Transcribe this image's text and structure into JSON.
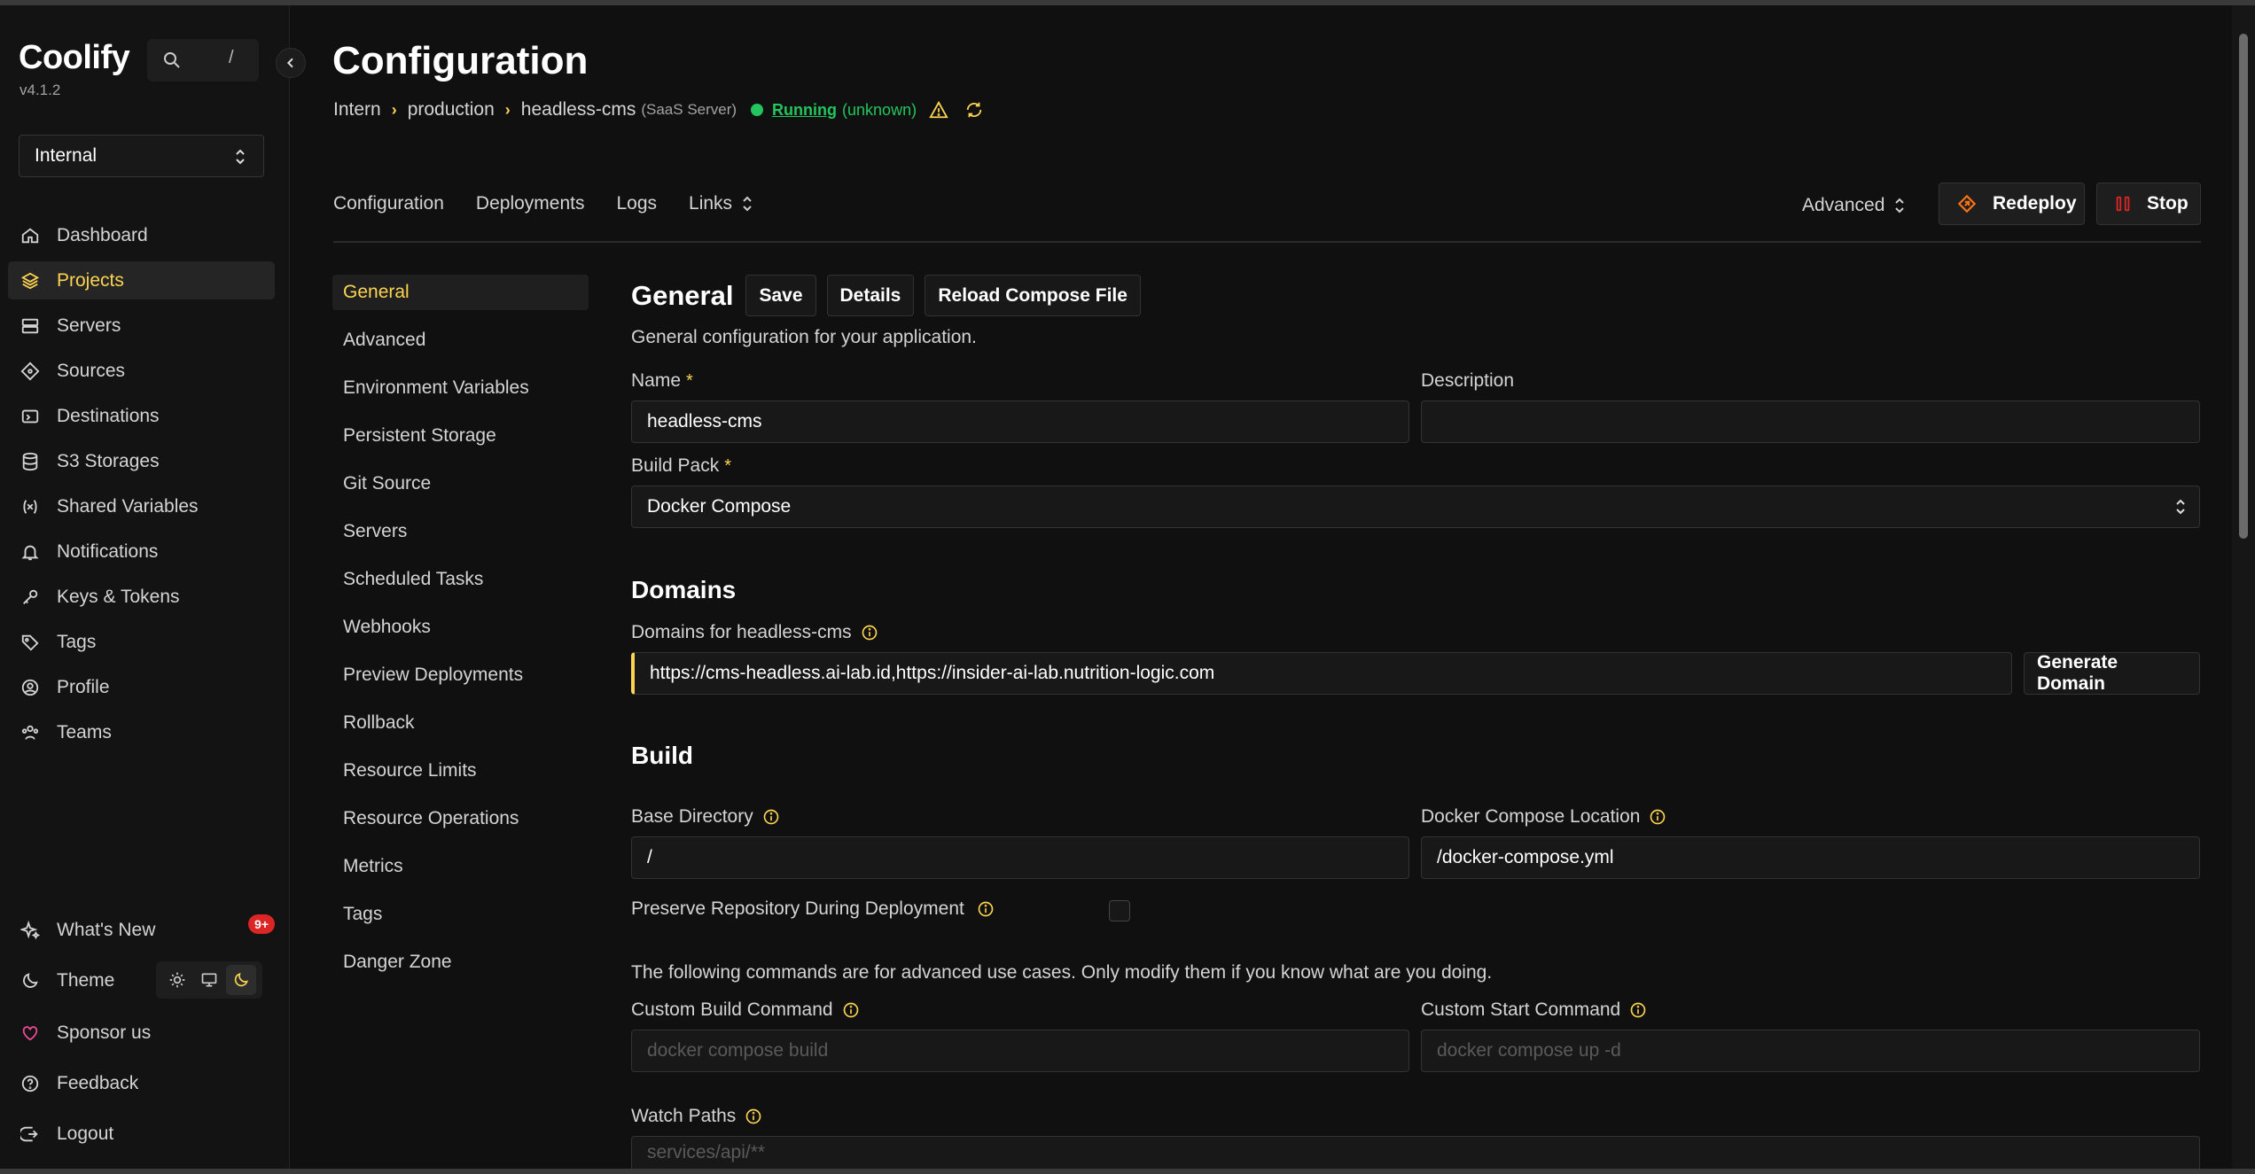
{
  "app": {
    "name": "Coolify",
    "version": "v4.1.2"
  },
  "search": {
    "shortcut": "/"
  },
  "team": {
    "selected": "Internal"
  },
  "sidebar": {
    "items": [
      {
        "label": "Dashboard",
        "icon": "home-icon"
      },
      {
        "label": "Projects",
        "icon": "layers-icon",
        "active": true
      },
      {
        "label": "Servers",
        "icon": "server-icon"
      },
      {
        "label": "Sources",
        "icon": "git-icon"
      },
      {
        "label": "Destinations",
        "icon": "destination-icon"
      },
      {
        "label": "S3 Storages",
        "icon": "database-icon"
      },
      {
        "label": "Shared Variables",
        "icon": "variable-icon"
      },
      {
        "label": "Notifications",
        "icon": "bell-icon"
      },
      {
        "label": "Keys & Tokens",
        "icon": "key-icon"
      },
      {
        "label": "Tags",
        "icon": "tag-icon"
      },
      {
        "label": "Profile",
        "icon": "user-icon"
      },
      {
        "label": "Teams",
        "icon": "users-icon"
      }
    ],
    "bottom": {
      "whats_new": "What's New",
      "whats_new_badge": "9+",
      "theme": "Theme",
      "sponsor": "Sponsor us",
      "feedback": "Feedback",
      "logout": "Logout"
    }
  },
  "header": {
    "title": "Configuration",
    "breadcrumb": [
      "Intern",
      "production",
      "headless-cms"
    ],
    "server": "(SaaS Server)",
    "status": "Running",
    "status_detail": "(unknown)"
  },
  "tabs": [
    "Configuration",
    "Deployments",
    "Logs",
    "Links"
  ],
  "actions": {
    "advanced": "Advanced",
    "redeploy": "Redeploy",
    "stop": "Stop"
  },
  "colors": {
    "accent": "#fcd452",
    "running": "#22c55e",
    "stop": "#dc2626",
    "badge": "#dc2626"
  },
  "subnav": [
    "General",
    "Advanced",
    "Environment Variables",
    "Persistent Storage",
    "Git Source",
    "Servers",
    "Scheduled Tasks",
    "Webhooks",
    "Preview Deployments",
    "Rollback",
    "Resource Limits",
    "Resource Operations",
    "Metrics",
    "Tags",
    "Danger Zone"
  ],
  "general": {
    "title": "General",
    "save": "Save",
    "details": "Details",
    "reload": "Reload Compose File",
    "subtitle": "General configuration for your application.",
    "name_label": "Name",
    "name_value": "headless-cms",
    "description_label": "Description",
    "description_value": "",
    "buildpack_label": "Build Pack",
    "buildpack_value": "Docker Compose"
  },
  "domains": {
    "title": "Domains",
    "label": "Domains for headless-cms",
    "value": "https://cms-headless.ai-lab.id,https://insider-ai-lab.nutrition-logic.com",
    "generate": "Generate Domain"
  },
  "build": {
    "title": "Build",
    "base_dir_label": "Base Directory",
    "base_dir_value": "/",
    "compose_location_label": "Docker Compose Location",
    "compose_location_value": "/docker-compose.yml",
    "preserve_label": "Preserve Repository During Deployment",
    "warning": "The following commands are for advanced use cases. Only modify them if you know what are you doing.",
    "build_cmd_label": "Custom Build Command",
    "build_cmd_placeholder": "docker compose build",
    "start_cmd_label": "Custom Start Command",
    "start_cmd_placeholder": "docker compose up -d",
    "watch_label": "Watch Paths",
    "watch_placeholder": "services/api/**"
  }
}
